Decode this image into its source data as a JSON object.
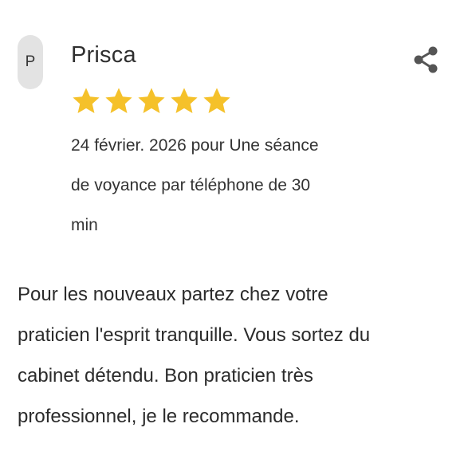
{
  "review": {
    "avatar_initial": "P",
    "reviewer_name": "Prisca",
    "rating": 5,
    "rating_max": 5,
    "meta_line_1": "24 février. 2026 pour Une séance",
    "meta_line_2": "de voyance par téléphone de 30",
    "meta_line_3": "min",
    "body_line_1": "Pour les nouveaux partez chez votre",
    "body_line_2": "praticien l'esprit tranquille. Vous sortez du",
    "body_line_3": "cabinet détendu. Bon praticien très",
    "body_line_4": "professionnel, je le recommande."
  },
  "icons": {
    "share": "share-icon",
    "star": "star-icon"
  },
  "colors": {
    "star": "#f5c12a",
    "avatar_bg": "#e3e3e3",
    "share_icon": "#555555",
    "text": "#2b2b2b"
  }
}
